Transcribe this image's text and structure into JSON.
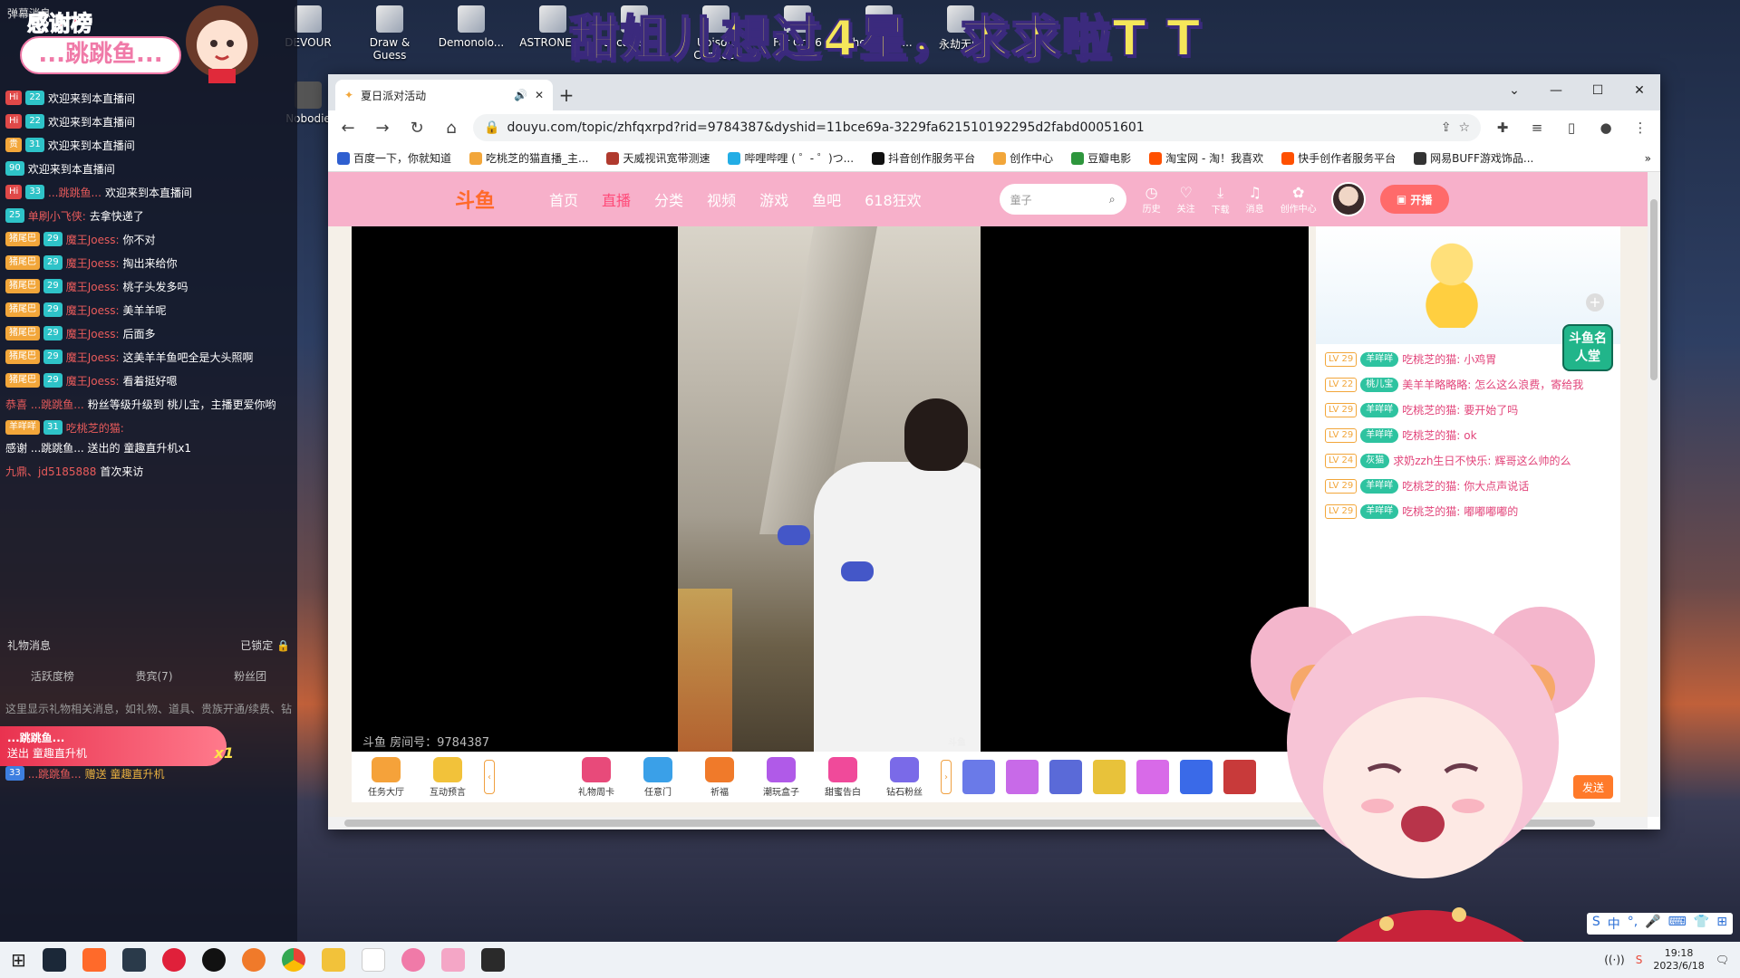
{
  "overlay": {
    "title": "甜姐儿想过4星，求求啦T T",
    "thanks_label": "感谢榜",
    "bubble_name": "...跳跳鱼...",
    "app_name": "弹幕消息"
  },
  "desktop": {
    "icons": [
      {
        "label": "DEVOUR"
      },
      {
        "label": "Draw & Guess"
      },
      {
        "label": "Demonolo..."
      },
      {
        "label": "ASTRONEER"
      },
      {
        "label": "Escapists 2"
      },
      {
        "label": "Ubisoft Connect"
      },
      {
        "label": "Far Cry 6"
      },
      {
        "label": "The Highri..."
      },
      {
        "label": "永劫无间"
      }
    ],
    "left_icon": "Nobodie"
  },
  "left_chat": {
    "lines": [
      {
        "badge": "Hi",
        "lv": "22",
        "user": "",
        "msg": "欢迎来到本直播间"
      },
      {
        "badge": "Hi",
        "lv": "22",
        "user": "",
        "msg": "欢迎来到本直播间"
      },
      {
        "badge": "贵",
        "lv": "31",
        "user": "",
        "msg": "欢迎来到本直播间"
      },
      {
        "badge": "",
        "lv": "90",
        "user": "",
        "msg": "欢迎来到本直播间"
      },
      {
        "badge": "Hi",
        "lv": "33",
        "user": "...跳跳鱼...",
        "msg": "欢迎来到本直播间"
      },
      {
        "badge": "",
        "lv": "25",
        "user": "单刷小飞侠:",
        "msg": "去拿快递了"
      },
      {
        "badge": "猪尾巴",
        "lv": "29",
        "user": "魔王Joess:",
        "msg": "你不对"
      },
      {
        "badge": "猪尾巴",
        "lv": "29",
        "user": "魔王Joess:",
        "msg": "掏出来给你"
      },
      {
        "badge": "猪尾巴",
        "lv": "29",
        "user": "魔王Joess:",
        "msg": "桃子头发多吗"
      },
      {
        "badge": "猪尾巴",
        "lv": "29",
        "user": "魔王Joess:",
        "msg": "美羊羊呢"
      },
      {
        "badge": "猪尾巴",
        "lv": "29",
        "user": "魔王Joess:",
        "msg": "后面多"
      },
      {
        "badge": "猪尾巴",
        "lv": "29",
        "user": "魔王Joess:",
        "msg": "这美羊羊鱼吧全是大头照啊"
      },
      {
        "badge": "猪尾巴",
        "lv": "29",
        "user": "魔王Joess:",
        "msg": "看着挺好嗯"
      },
      {
        "badge": "",
        "lv": "",
        "user": "恭喜 ...跳跳鱼...",
        "msg": "粉丝等级升级到 桃儿宝，主播更爱你哟"
      },
      {
        "badge": "羊咩咩",
        "lv": "31",
        "user": "吃桃芝的猫:",
        "msg": "感谢 ...跳跳鱼... 送出的 童趣直升机x1"
      },
      {
        "badge": "",
        "lv": "",
        "user": "九鼎、jd5185888",
        "msg": "首次来访"
      }
    ],
    "gift_title": "礼物消息",
    "gift_lock": "已锁定",
    "gift_tabs": [
      "活跃度榜",
      "贵宾(7)",
      "粉丝团"
    ],
    "gift_note": "这里显示礼物相关消息，如礼物、道具、贵族开通/续费、钻",
    "gift_pop_name": "...跳跳鱼...",
    "gift_pop_text": "送出 童趣直升机",
    "gift_pop_count": "x1",
    "gift_last_lv": "33",
    "gift_last_user": "...跳跳鱼...",
    "gift_last_msg": "赠送 童趣直升机"
  },
  "browser": {
    "tab_title": "夏日派对活动",
    "url": "douyu.com/topic/zhfqxrpd?rid=9784387&dyshid=11bce69a-3229fa621510192295d2fabd00051601",
    "bookmarks": [
      {
        "label": "百度一下，你就知道",
        "color": "#2f5fd0"
      },
      {
        "label": "吃桃芝的猫直播_主...",
        "color": "#f2a63a"
      },
      {
        "label": "天威视讯宽带测速",
        "color": "#b03a2e"
      },
      {
        "label": "哔哩哔哩 ( ゜- ゜)つ...",
        "color": "#23ade5"
      },
      {
        "label": "抖音创作服务平台",
        "color": "#111111"
      },
      {
        "label": "创作中心",
        "color": "#f2a63a"
      },
      {
        "label": "豆瓣电影",
        "color": "#2e963d"
      },
      {
        "label": "淘宝网 - 淘！我喜欢",
        "color": "#ff5000"
      },
      {
        "label": "快手创作者服务平台",
        "color": "#ff5000"
      },
      {
        "label": "网易BUFF游戏饰品...",
        "color": "#333333"
      }
    ]
  },
  "douyu": {
    "logo": "斗鱼",
    "nav": [
      "首页",
      "直播",
      "分类",
      "视频",
      "游戏",
      "鱼吧",
      "618狂欢"
    ],
    "active_nav": "直播",
    "search_placeholder": "童子",
    "icons": [
      {
        "icon": "history-icon",
        "label": "历史"
      },
      {
        "icon": "heart-icon",
        "label": "关注"
      },
      {
        "icon": "download-icon",
        "label": "下载"
      },
      {
        "icon": "bell-icon",
        "label": "消息"
      },
      {
        "icon": "creator-icon",
        "label": "创作中心"
      }
    ],
    "live_btn": "开播",
    "room_id": "斗鱼 房间号：9784387",
    "watermark": "斗鱼",
    "giftbar": [
      {
        "label": "任务大厅",
        "color": "#f5a23a"
      },
      {
        "label": "互动预言",
        "color": "#f2c23a"
      },
      {
        "label": "礼物周卡",
        "color": "#e84a7a"
      },
      {
        "label": "任意门",
        "color": "#3aa0e8"
      },
      {
        "label": "祈福",
        "color": "#f07a2a"
      },
      {
        "label": "潮玩盒子",
        "color": "#b05ae8"
      },
      {
        "label": "甜蜜告白",
        "color": "#f04a9a"
      },
      {
        "label": "钻石粉丝",
        "color": "#7a6ae8"
      }
    ],
    "send_label": "发送",
    "rank_badge": "斗鱼名人堂"
  },
  "right_chat": [
    {
      "lv": "LV 29",
      "fan": "羊咩咩",
      "user": "吃桃芝的猫:",
      "msg": "小鸡胃"
    },
    {
      "lv": "LV 22",
      "fan": "桃儿宝",
      "user": "美羊羊略略略:",
      "msg": "怎么这么浪费，寄给我"
    },
    {
      "lv": "LV 29",
      "fan": "羊咩咩",
      "user": "吃桃芝的猫:",
      "msg": "要开始了吗"
    },
    {
      "lv": "LV 29",
      "fan": "羊咩咩",
      "user": "吃桃芝的猫:",
      "msg": "ok"
    },
    {
      "lv": "LV 24",
      "fan": "灰猫",
      "user": "求奶zzh生日不快乐:",
      "msg": "辉哥这么帅的么"
    },
    {
      "lv": "LV 29",
      "fan": "羊咩咩",
      "user": "吃桃芝的猫:",
      "msg": "你大点声说话"
    },
    {
      "lv": "LV 29",
      "fan": "羊咩咩",
      "user": "吃桃芝的猫:",
      "msg": "嘟嘟嘟嘟的"
    }
  ],
  "taskbar": {
    "time": "19:18",
    "date": "2023/6/18",
    "ime": [
      "S",
      "中",
      "°,",
      "🎤",
      "⌨",
      "👕",
      "⊞"
    ]
  }
}
